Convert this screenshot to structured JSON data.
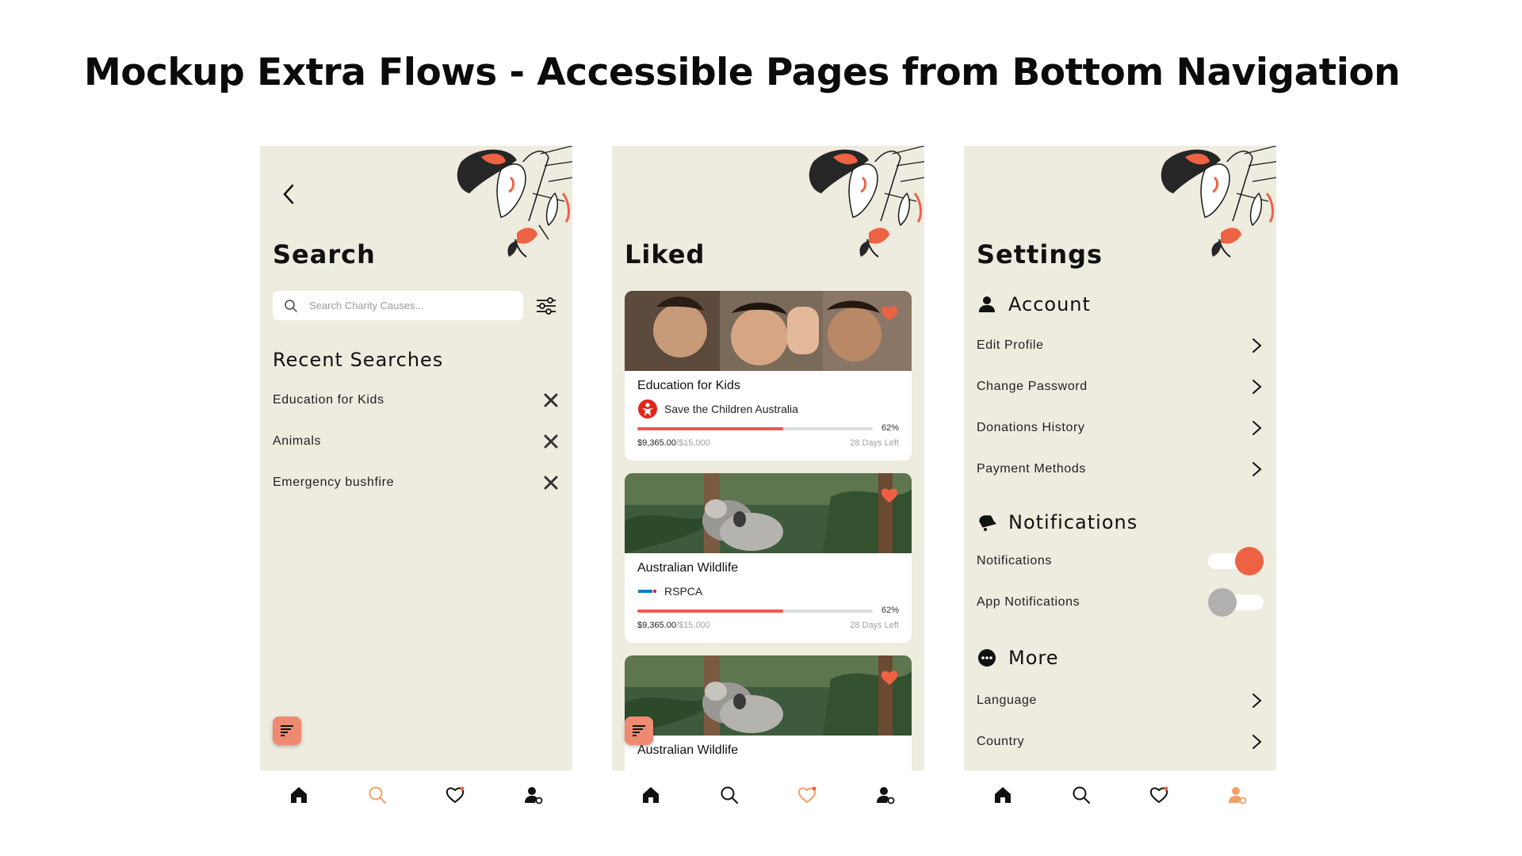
{
  "heading": "Mockup Extra Flows - Accessible Pages from Bottom Navigation",
  "colors": {
    "screen_bg": "#eeebdf",
    "accent": "#ee6244",
    "nav_active": "#f1a066",
    "toggle_on": "#ee6244",
    "toggle_off": "#b2b0ae",
    "progress": "#ec5a4e"
  },
  "nav_icons": [
    "home-icon",
    "search-icon",
    "heart-icon",
    "profile-settings-icon"
  ],
  "search_screen": {
    "title": "Search",
    "search_placeholder": "Search Charity Causes...",
    "recent_title": "Recent Searches",
    "recent": [
      "Education for Kids",
      "Animals",
      "Emergency bushfire"
    ],
    "active_nav": "search"
  },
  "liked_screen": {
    "title": "Liked",
    "active_nav": "liked",
    "cards": [
      {
        "title": "Education for Kids",
        "org": "Save the Children Australia",
        "progress": 62,
        "pct_label": "62%",
        "raised": "$9,365.00",
        "goal": "/$15,000",
        "days": "28 Days Left"
      },
      {
        "title": "Australian Wildlife",
        "org": "RSPCA",
        "progress": 62,
        "pct_label": "62%",
        "raised": "$9,365.00",
        "goal": "/$15,000",
        "days": "28 Days Left"
      },
      {
        "title": "Australian Wildlife"
      }
    ]
  },
  "settings_screen": {
    "title": "Settings",
    "active_nav": "profile",
    "account_title": "Account",
    "account_items": [
      "Edit Profile",
      "Change Password",
      "Donations History",
      "Payment Methods"
    ],
    "notifications_title": "Notifications",
    "notification_items": [
      {
        "label": "Notifications",
        "on": true
      },
      {
        "label": "App Notifications",
        "on": false
      }
    ],
    "more_title": "More",
    "more_items": [
      "Language",
      "Country"
    ]
  }
}
